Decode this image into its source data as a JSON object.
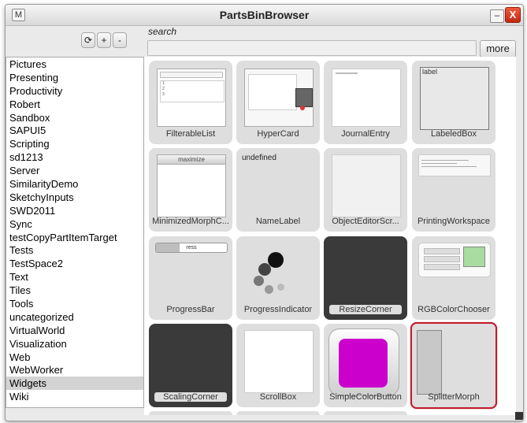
{
  "window": {
    "title": "PartsBinBrowser",
    "menu_label": "M",
    "minimize_label": "–",
    "close_label": "X"
  },
  "toolbar": {
    "refresh_label": "⟳",
    "add_label": "+",
    "remove_label": "-"
  },
  "search": {
    "label": "search",
    "value": "",
    "more_label": "more"
  },
  "categories": [
    "Pictures",
    "Presenting",
    "Productivity",
    "Robert",
    "Sandbox",
    "SAPUI5",
    "Scripting",
    "sd1213",
    "Server",
    "SimilarityDemo",
    "SketchyInputs",
    "SWD2011",
    "Sync",
    "testCopyPartItemTarget",
    "Tests",
    "TestSpace2",
    "Text",
    "Tiles",
    "Tools",
    "uncategorized",
    "VirtualWorld",
    "Visualization",
    "Web",
    "WebWorker",
    "Widgets",
    "Wiki"
  ],
  "selected_category": "Widgets",
  "parts": [
    {
      "name": "FilterableList"
    },
    {
      "name": "HyperCard"
    },
    {
      "name": "JournalEntry"
    },
    {
      "name": "LabeledBox",
      "thumb_text": "label"
    },
    {
      "name": "MinimizedMorphC...",
      "thumb_text": "maximize"
    },
    {
      "name": "NameLabel",
      "thumb_text": "undefined"
    },
    {
      "name": "ObjectEditorScr..."
    },
    {
      "name": "PrintingWorkspace"
    },
    {
      "name": "ProgressBar",
      "thumb_text": "ress"
    },
    {
      "name": "ProgressIndicator"
    },
    {
      "name": "ResizeCorner"
    },
    {
      "name": "RGBColorChooser"
    },
    {
      "name": "ScalingCorner"
    },
    {
      "name": "ScrollBox"
    },
    {
      "name": "SimpleColorButton"
    },
    {
      "name": "SplitterMorph"
    }
  ],
  "colors": {
    "selection_border": "#c21b2b",
    "color_button": "#cc00cc",
    "rgb_preview": "#a8dca0",
    "dark_part": "#3a3a3a"
  }
}
